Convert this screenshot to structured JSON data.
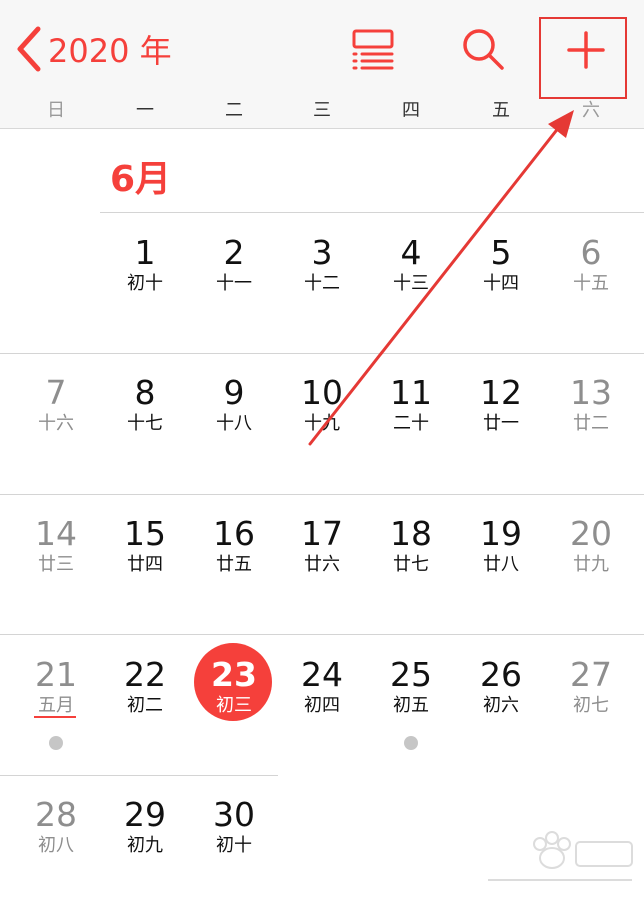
{
  "header": {
    "back_label": "2020 年"
  },
  "weekdays": [
    "日",
    "一",
    "二",
    "三",
    "四",
    "五",
    "六"
  ],
  "month": {
    "title": "6月"
  },
  "weeks": [
    [
      {
        "day": "1",
        "lunar": "初十"
      },
      {
        "day": "2",
        "lunar": "十一"
      },
      {
        "day": "3",
        "lunar": "十二"
      },
      {
        "day": "4",
        "lunar": "十三"
      },
      {
        "day": "5",
        "lunar": "十四"
      },
      {
        "day": "6",
        "lunar": "十五"
      }
    ],
    [
      {
        "day": "7",
        "lunar": "十六"
      },
      {
        "day": "8",
        "lunar": "十七"
      },
      {
        "day": "9",
        "lunar": "十八"
      },
      {
        "day": "10",
        "lunar": "十九"
      },
      {
        "day": "11",
        "lunar": "二十"
      },
      {
        "day": "12",
        "lunar": "廿一"
      },
      {
        "day": "13",
        "lunar": "廿二"
      }
    ],
    [
      {
        "day": "14",
        "lunar": "廿三"
      },
      {
        "day": "15",
        "lunar": "廿四"
      },
      {
        "day": "16",
        "lunar": "廿五"
      },
      {
        "day": "17",
        "lunar": "廿六"
      },
      {
        "day": "18",
        "lunar": "廿七"
      },
      {
        "day": "19",
        "lunar": "廿八"
      },
      {
        "day": "20",
        "lunar": "廿九"
      }
    ],
    [
      {
        "day": "21",
        "lunar": "五月"
      },
      {
        "day": "22",
        "lunar": "初二"
      },
      {
        "day": "23",
        "lunar": "初三"
      },
      {
        "day": "24",
        "lunar": "初四"
      },
      {
        "day": "25",
        "lunar": "初五"
      },
      {
        "day": "26",
        "lunar": "初六"
      },
      {
        "day": "27",
        "lunar": "初七"
      }
    ],
    [
      {
        "day": "28",
        "lunar": "初八"
      },
      {
        "day": "29",
        "lunar": "初九"
      },
      {
        "day": "30",
        "lunar": "初十"
      }
    ]
  ],
  "colors": {
    "accent": "#f5403b",
    "annotation": "#e53935",
    "weekend_text": "#8e8e8e",
    "event_dot": "#c6c6c6"
  },
  "icons": {
    "back": "chevron-left-icon",
    "list": "list-view-icon",
    "search": "search-icon",
    "add": "plus-icon"
  }
}
